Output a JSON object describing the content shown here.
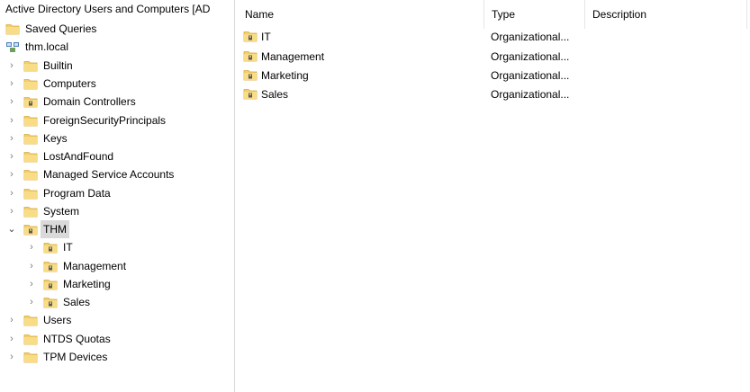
{
  "tree": {
    "root_label": "Active Directory Users and Computers [AD",
    "saved_queries": "Saved Queries",
    "domain": "thm.local",
    "nodes": [
      "Builtin",
      "Computers",
      "Domain Controllers",
      "ForeignSecurityPrincipals",
      "Keys",
      "LostAndFound",
      "Managed Service Accounts",
      "Program Data",
      "System",
      "THM",
      "IT",
      "Management",
      "Marketing",
      "Sales",
      "Users",
      "NTDS Quotas",
      "TPM Devices"
    ]
  },
  "list": {
    "columns": [
      "Name",
      "Type",
      "Description"
    ],
    "rows": [
      {
        "name": "IT",
        "type": "Organizational..."
      },
      {
        "name": "Management",
        "type": "Organizational..."
      },
      {
        "name": "Marketing",
        "type": "Organizational..."
      },
      {
        "name": "Sales",
        "type": "Organizational..."
      }
    ]
  },
  "colors": {
    "folder": "#f2cf6b",
    "folder_dark": "#d8a93a",
    "selection": "#d9d9d9"
  }
}
